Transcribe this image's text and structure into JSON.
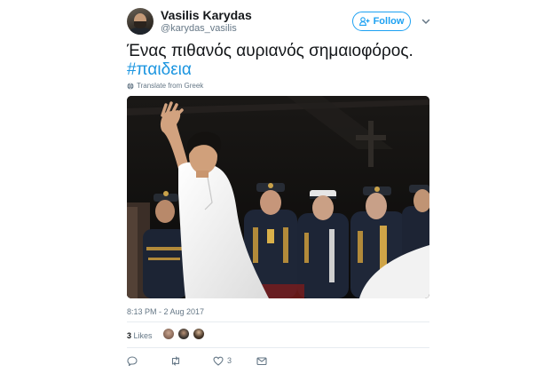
{
  "author": {
    "display_name": "Vasilis Karydas",
    "handle": "@karydas_vasilis"
  },
  "follow_button": {
    "label": "Follow"
  },
  "tweet": {
    "text": "Ένας πιθανός αυριανός σημαιοφόρος.",
    "hashtag": "#παιδεια",
    "translate_label": "Translate from Greek"
  },
  "meta": {
    "timestamp": "8:13 PM - 2 Aug 2017",
    "likes_count": "3",
    "likes_label": "Likes"
  },
  "actions": {
    "reply_icon": "reply-icon",
    "retweet_icon": "retweet-icon",
    "like_count": "3",
    "dm_icon": "envelope-icon"
  },
  "colors": {
    "accent": "#1da1f2",
    "hashtag": "#1b95e0",
    "muted": "#657786",
    "text": "#14171a"
  }
}
